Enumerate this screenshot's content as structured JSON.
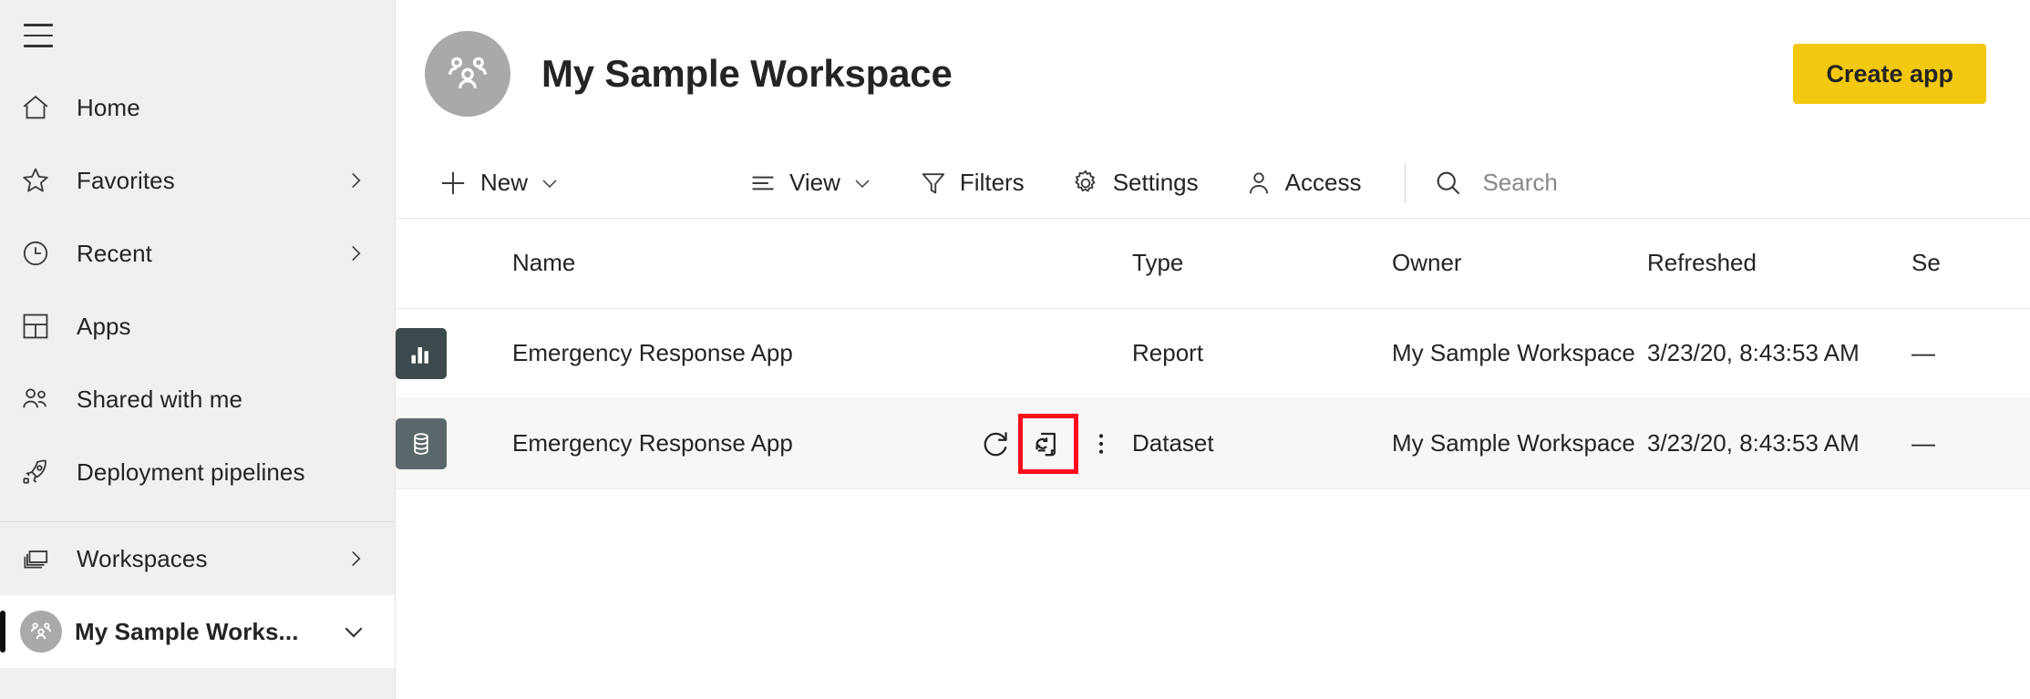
{
  "sidebar": {
    "hamburger_label": "Navigation menu",
    "items": [
      {
        "label": "Home",
        "icon": "home-icon",
        "chevron": false,
        "active": false
      },
      {
        "label": "Favorites",
        "icon": "star-icon",
        "chevron": true,
        "active": false
      },
      {
        "label": "Recent",
        "icon": "clock-icon",
        "chevron": true,
        "active": false
      },
      {
        "label": "Apps",
        "icon": "apps-grid-icon",
        "chevron": false,
        "active": false
      },
      {
        "label": "Shared with me",
        "icon": "people-icon",
        "chevron": false,
        "active": false
      },
      {
        "label": "Deployment pipelines",
        "icon": "rocket-icon",
        "chevron": false,
        "active": false
      }
    ],
    "workspaces_group": [
      {
        "label": "Workspaces",
        "icon": "stacked-windows-icon",
        "chevron": true,
        "active": false
      }
    ],
    "active_workspace": {
      "label": "My Sample Works...",
      "icon": "workspace-group-avatar",
      "chevron": "chevron-down-icon",
      "active": true
    }
  },
  "header": {
    "avatar_icon": "workspace-group-avatar",
    "title": "My Sample Workspace",
    "create_app_label": "Create app",
    "accent_color": "#f2c811"
  },
  "toolbar": {
    "new_label": "New",
    "new_icon": "plus-icon",
    "view_label": "View",
    "view_icon": "view-lines-icon",
    "filters_label": "Filters",
    "filters_icon": "funnel-icon",
    "settings_label": "Settings",
    "settings_icon": "gear-icon",
    "access_label": "Access",
    "access_icon": "person-icon",
    "search_icon": "search-icon",
    "search_placeholder": "Search",
    "search_value": ""
  },
  "table": {
    "columns": [
      "Name",
      "Type",
      "Owner",
      "Refreshed",
      "Se"
    ],
    "rows": [
      {
        "icon": "report-bar-chart-icon",
        "icon_kind": "report",
        "name": "Emergency Response App",
        "type": "Report",
        "owner": "My Sample Workspace",
        "refreshed": "3/23/20, 8:43:53 AM",
        "sensitivity": "—",
        "hovered": false,
        "actions": []
      },
      {
        "icon": "dataset-database-icon",
        "icon_kind": "dataset",
        "name": "Emergency Response App",
        "type": "Dataset",
        "owner": "My Sample Workspace",
        "refreshed": "3/23/20, 8:43:53 AM",
        "sensitivity": "—",
        "hovered": true,
        "actions": [
          {
            "name": "refresh-now-button",
            "icon": "refresh-circular-arrow-icon",
            "highlighted": false
          },
          {
            "name": "schedule-refresh-button",
            "icon": "page-refresh-icon",
            "highlighted": true
          },
          {
            "name": "more-options-button",
            "icon": "ellipsis-vertical-icon",
            "highlighted": false
          }
        ]
      }
    ]
  },
  "annotation": {
    "highlight_color": "#fc0d1b",
    "target": "schedule-refresh-button"
  }
}
